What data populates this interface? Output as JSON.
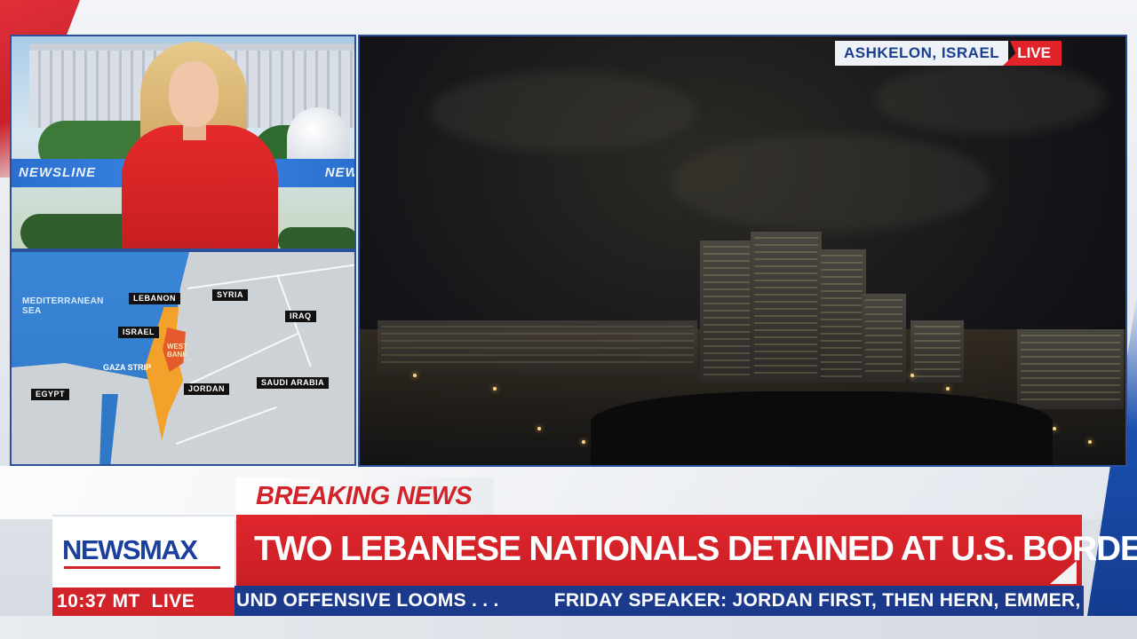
{
  "location_badge": {
    "location": "ASHKELON, ISRAEL",
    "live": "LIVE"
  },
  "studio_ticker": {
    "text": "NEWSLINE"
  },
  "map": {
    "sea_label": "MEDITERRANEAN SEA",
    "countries": {
      "lebanon": "LEBANON",
      "syria": "SYRIA",
      "iraq": "IRAQ",
      "israel": "ISRAEL",
      "gaza": "GAZA STRIP",
      "west_bank": "WEST BANK",
      "jordan": "JORDAN",
      "saudi_arabia": "SAUDI ARABIA",
      "egypt": "EGYPT"
    },
    "colors": {
      "sea": "#2f78c8",
      "israel": "#f2a12b",
      "west_bank": "#e45a2c"
    }
  },
  "lower_third": {
    "breaking_label": "BREAKING NEWS",
    "logo": "NEWSMAX",
    "headline": "TWO LEBANESE NATIONALS DETAINED AT U.S. BORDER",
    "time": "10:37 MT",
    "time_live": "LIVE",
    "ticker_left": "UND OFFENSIVE LOOMS . . .",
    "ticker_right": "FRIDAY SPEAKER: JORDAN FIRST, THEN HERN, EMMER, M"
  },
  "colors": {
    "brand_red": "#d2232a",
    "brand_blue": "#1b3a8c",
    "logo_blue": "#1a3f9c"
  }
}
